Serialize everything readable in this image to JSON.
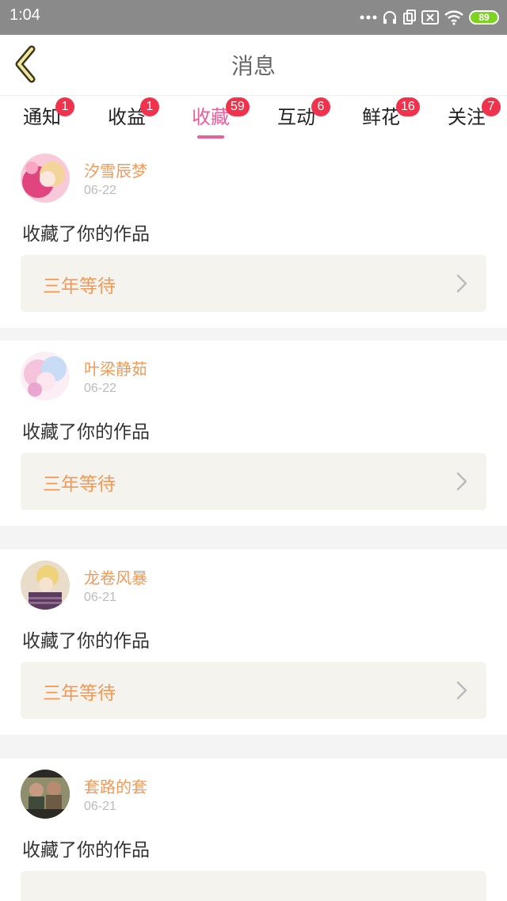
{
  "status_bar": {
    "time": "1:04",
    "battery": "89",
    "icons": [
      "more-dots-icon",
      "headphones-icon",
      "sim-icon",
      "no-signal-icon",
      "wifi-icon",
      "battery-icon"
    ]
  },
  "header": {
    "title": "消息",
    "back_icon": "chevron-left-icon"
  },
  "tabs": [
    {
      "label": "通知",
      "badge": "1",
      "active": false
    },
    {
      "label": "收益",
      "badge": "1",
      "active": false
    },
    {
      "label": "收藏",
      "badge": "59",
      "active": true
    },
    {
      "label": "互动",
      "badge": "6",
      "active": false
    },
    {
      "label": "鲜花",
      "badge": "16",
      "active": false
    },
    {
      "label": "关注",
      "badge": "7",
      "active": false
    }
  ],
  "messages": [
    {
      "username": "汐雪辰梦",
      "date": "06-22",
      "action": "收藏了你的作品",
      "work_title": "三年等待"
    },
    {
      "username": "叶梁静茹",
      "date": "06-22",
      "action": "收藏了你的作品",
      "work_title": "三年等待"
    },
    {
      "username": "龙卷风暴",
      "date": "06-21",
      "action": "收藏了你的作品",
      "work_title": "三年等待"
    },
    {
      "username": "套路的套",
      "date": "06-21",
      "action": "收藏了你的作品",
      "work_title": ""
    }
  ],
  "colors": {
    "accent": "#e8609a",
    "username": "#f09a5a",
    "badge": "#f0324c",
    "status_bar": "#8a8a8a",
    "battery": "#7ed321"
  }
}
